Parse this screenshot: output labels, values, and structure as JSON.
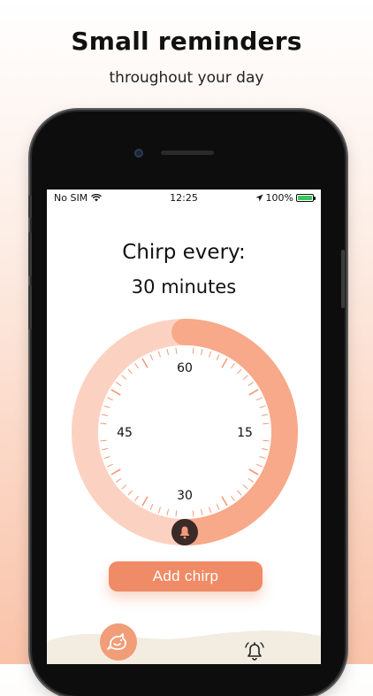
{
  "promo": {
    "headline": "Small reminders",
    "subheadline": "throughout your day"
  },
  "status_bar": {
    "carrier": "No SIM",
    "time": "12:25",
    "battery": "100%"
  },
  "screen": {
    "title": "Chirp every:",
    "interval_value": "30 minutes",
    "dial": {
      "labels": {
        "top": "60",
        "right": "15",
        "bottom": "30",
        "left": "45"
      },
      "selected_fraction": 0.5,
      "colors": {
        "track": "#fbd2c2",
        "progress": "#f7a98a",
        "handle": "#3a2a28",
        "ticks": "#f29a7a"
      }
    },
    "add_button_label": "Add chirp",
    "tabs": [
      {
        "icon": "bird-icon",
        "active": true
      },
      {
        "icon": "bell-icon",
        "active": false
      }
    ]
  },
  "colors": {
    "accent": "#ef8b66",
    "background_gradient_end": "#f9c3a9"
  }
}
